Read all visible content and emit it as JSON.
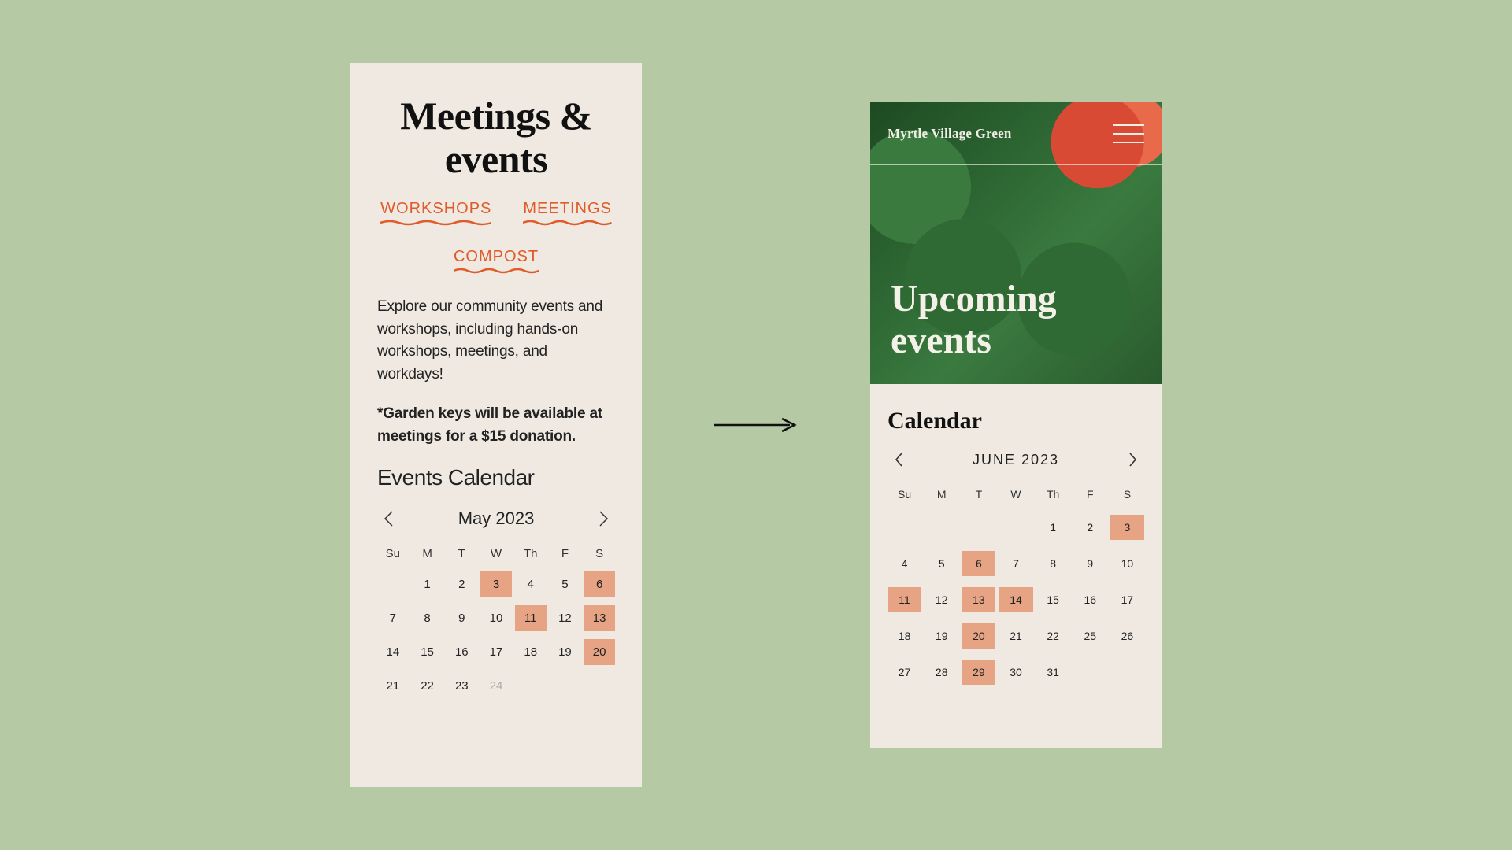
{
  "left": {
    "title": "Meetings & events",
    "tabs": [
      "WORKSHOPS",
      "MEETINGS",
      "COMPOST"
    ],
    "intro": "Explore our community events and workshops, including hands-on workshops, meetings, and workdays!",
    "note": "*Garden keys will be available at meetings for a $15 donation.",
    "calendarHeading": "Events Calendar",
    "calendar": {
      "month": "May 2023",
      "dow": [
        "Su",
        "M",
        "T",
        "W",
        "Th",
        "F",
        "S"
      ],
      "leadingBlanks": 1,
      "days": [
        {
          "n": 1
        },
        {
          "n": 2
        },
        {
          "n": 3,
          "hl": true
        },
        {
          "n": 4
        },
        {
          "n": 5
        },
        {
          "n": 6,
          "hl": true
        },
        {
          "n": 7
        },
        {
          "n": 8
        },
        {
          "n": 9
        },
        {
          "n": 10
        },
        {
          "n": 11,
          "hl": true
        },
        {
          "n": 12
        },
        {
          "n": 13,
          "hl": true
        },
        {
          "n": 14
        },
        {
          "n": 15
        },
        {
          "n": 16
        },
        {
          "n": 17
        },
        {
          "n": 18
        },
        {
          "n": 19
        },
        {
          "n": 20,
          "hl": true
        },
        {
          "n": 21
        },
        {
          "n": 22
        },
        {
          "n": 23
        },
        {
          "n": 24,
          "dim": true
        }
      ]
    }
  },
  "right": {
    "brand": "Myrtle Village Green",
    "heroTitle": "Upcoming events",
    "calendarTitle": "Calendar",
    "calendar": {
      "month": "JUNE  2023",
      "dow": [
        "Su",
        "M",
        "T",
        "W",
        "Th",
        "F",
        "S"
      ],
      "leadingBlanks": 4,
      "days": [
        {
          "n": 1
        },
        {
          "n": 2
        },
        {
          "n": 3,
          "hl": true
        },
        {
          "n": 4
        },
        {
          "n": 5
        },
        {
          "n": 6,
          "hl": true
        },
        {
          "n": 7
        },
        {
          "n": 8
        },
        {
          "n": 9
        },
        {
          "n": 10
        },
        {
          "n": 11,
          "hl": true
        },
        {
          "n": 12
        },
        {
          "n": 13,
          "hl": true
        },
        {
          "n": 14,
          "hl": true
        },
        {
          "n": 15
        },
        {
          "n": 16
        },
        {
          "n": 17
        },
        {
          "n": 18
        },
        {
          "n": 19
        },
        {
          "n": 20,
          "hl": true
        },
        {
          "n": 21
        },
        {
          "n": 22
        },
        {
          "n": 25
        },
        {
          "n": 26
        },
        {
          "n": 27
        },
        {
          "n": 28
        },
        {
          "n": 29,
          "hl": true
        },
        {
          "n": 30
        },
        {
          "n": 31
        }
      ]
    }
  }
}
